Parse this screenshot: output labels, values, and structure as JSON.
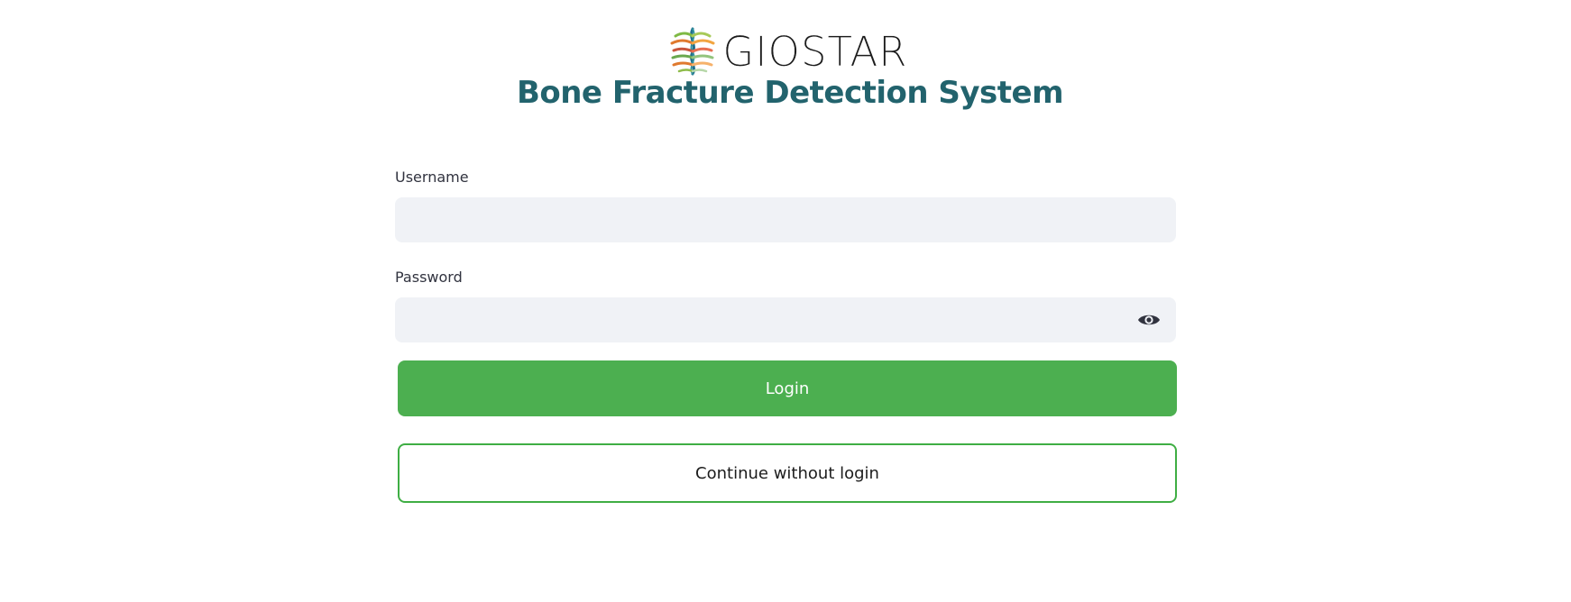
{
  "brand": {
    "logo_text": "GIOSTAR",
    "title": "Bone Fracture Detection System"
  },
  "login_form": {
    "username_label": "Username",
    "username_value": "",
    "password_label": "Password",
    "password_value": "",
    "password_toggle_icon": "eye-icon",
    "login_label": "Login",
    "continue_label": "Continue without login"
  },
  "colors": {
    "title": "#22636d",
    "primary_button": "#4caf50",
    "secondary_border": "#3fae44",
    "input_background": "#f0f2f6",
    "label_text": "#31333f"
  }
}
